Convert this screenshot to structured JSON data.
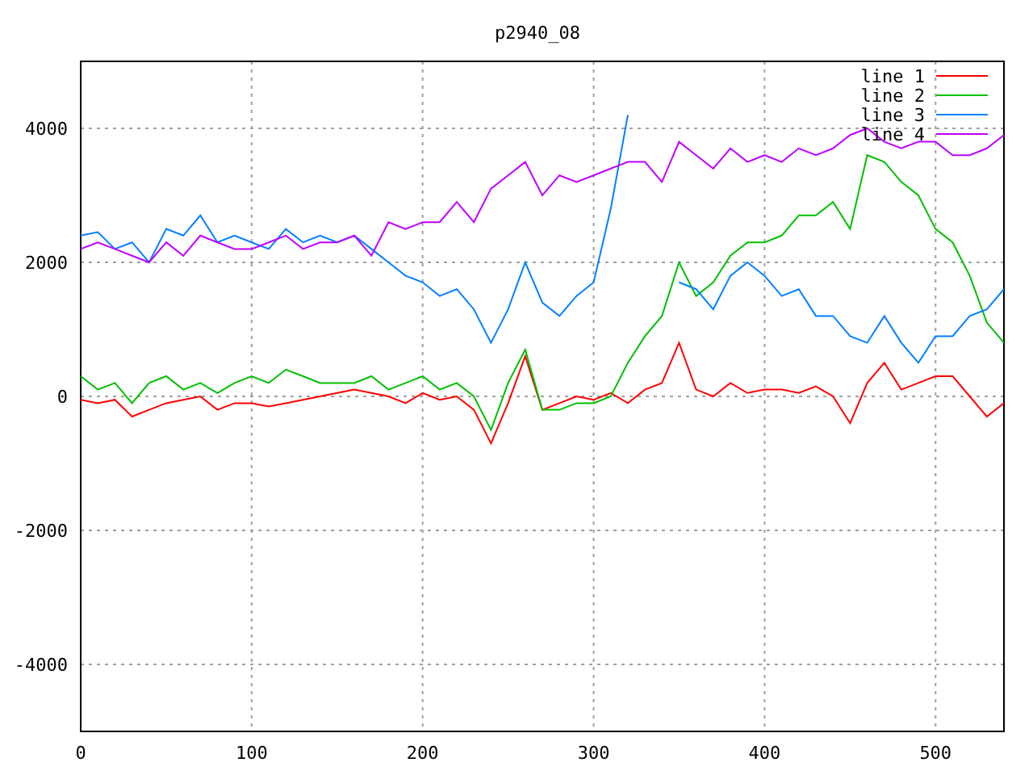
{
  "chart_data": {
    "type": "line",
    "title": "p2940_08",
    "x": [
      0,
      10,
      20,
      30,
      40,
      50,
      60,
      70,
      80,
      90,
      100,
      110,
      120,
      130,
      140,
      150,
      160,
      170,
      180,
      190,
      200,
      210,
      220,
      230,
      240,
      250,
      260,
      270,
      280,
      290,
      300,
      310,
      320,
      330,
      340,
      350,
      360,
      370,
      380,
      390,
      400,
      410,
      420,
      430,
      440,
      450,
      460,
      470,
      480,
      490,
      500,
      510,
      520,
      530,
      540
    ],
    "series": [
      {
        "name": "line 1",
        "color": "#ff0000",
        "values": [
          -50,
          -100,
          -50,
          -300,
          -200,
          -100,
          -50,
          0,
          -200,
          -100,
          -100,
          -150,
          -100,
          -50,
          0,
          50,
          100,
          50,
          0,
          -100,
          50,
          -50,
          0,
          -200,
          -700,
          -100,
          600,
          -200,
          -100,
          0,
          -50,
          50,
          -100,
          100,
          200,
          800,
          100,
          0,
          200,
          50,
          100,
          100,
          50,
          150,
          0,
          -400,
          200,
          500,
          100,
          200,
          300,
          300,
          0,
          -300,
          -100
        ]
      },
      {
        "name": "line 2",
        "color": "#00c000",
        "values": [
          300,
          100,
          200,
          -100,
          200,
          300,
          100,
          200,
          50,
          200,
          300,
          200,
          400,
          300,
          200,
          200,
          200,
          300,
          100,
          200,
          300,
          100,
          200,
          0,
          -500,
          200,
          700,
          -200,
          -200,
          -100,
          -100,
          0,
          500,
          900,
          1200,
          2000,
          1500,
          1700,
          2100,
          2300,
          2300,
          2400,
          2700,
          2700,
          2900,
          2500,
          3600,
          3500,
          3200,
          3000,
          2500,
          2300,
          1800,
          1100,
          800
        ]
      },
      {
        "name": "line 3",
        "color": "#0080ff",
        "values": [
          2400,
          2450,
          2200,
          2300,
          2000,
          2500,
          2400,
          2700,
          2300,
          2400,
          2300,
          2200,
          2500,
          2300,
          2400,
          2300,
          2400,
          2200,
          2000,
          1800,
          1700,
          1500,
          1600,
          1300,
          800,
          1300,
          2000,
          1400,
          1200,
          1500,
          1700,
          2800,
          4200,
          null,
          null,
          1700,
          1600,
          1300,
          1800,
          2000,
          1800,
          1500,
          1600,
          1200,
          1200,
          900,
          800,
          1200,
          800,
          500,
          900,
          900,
          1200,
          1300,
          1600
        ]
      },
      {
        "name": "line 4",
        "color": "#c000ff",
        "values": [
          2200,
          2300,
          2200,
          2100,
          2000,
          2300,
          2100,
          2400,
          2300,
          2200,
          2200,
          2300,
          2400,
          2200,
          2300,
          2300,
          2400,
          2100,
          2600,
          2500,
          2600,
          2600,
          2900,
          2600,
          3100,
          3300,
          3500,
          3000,
          3300,
          3200,
          3300,
          3400,
          3500,
          3500,
          3200,
          3800,
          3600,
          3400,
          3700,
          3500,
          3600,
          3500,
          3700,
          3600,
          3700,
          3900,
          4000,
          3800,
          3700,
          3800,
          3800,
          3600,
          3600,
          3700,
          3900
        ]
      }
    ],
    "grid": true,
    "legend": true,
    "xlim": [
      0,
      540
    ],
    "ylim": [
      -5000,
      5000
    ],
    "xticks": [
      0,
      100,
      200,
      300,
      400,
      500
    ],
    "yticks": [
      -4000,
      -2000,
      0,
      2000,
      4000
    ]
  }
}
